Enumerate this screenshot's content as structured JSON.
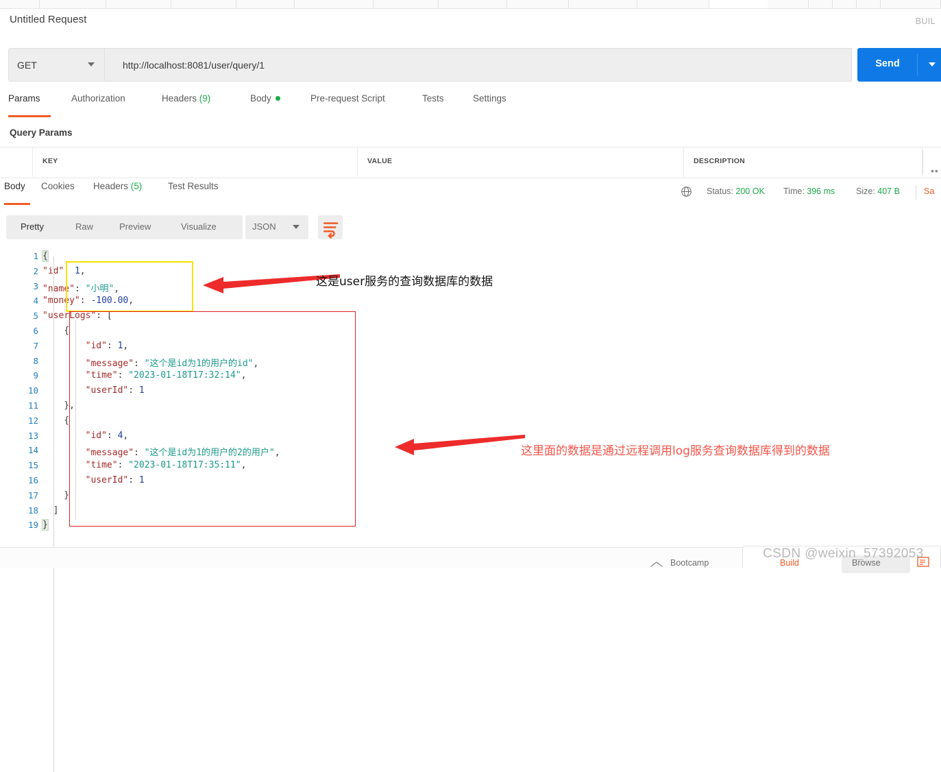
{
  "app": {
    "request_title": "Untitled Request",
    "build_label": "BUIL"
  },
  "url_bar": {
    "method": "GET",
    "url": "http://localhost:8081/user/query/1",
    "send_label": "Send"
  },
  "request_tabs": [
    {
      "label": "Params",
      "active": true
    },
    {
      "label": "Authorization",
      "active": false
    },
    {
      "label": "Headers",
      "count": "(9)",
      "active": false
    },
    {
      "label": "Body",
      "dot": true,
      "active": false
    },
    {
      "label": "Pre-request Script",
      "active": false
    },
    {
      "label": "Tests",
      "active": false
    },
    {
      "label": "Settings",
      "active": false
    }
  ],
  "params": {
    "section_title": "Query Params",
    "columns": [
      "KEY",
      "VALUE",
      "DESCRIPTION"
    ],
    "overflow_label": "••"
  },
  "response_tabs": [
    {
      "label": "Body",
      "active": true
    },
    {
      "label": "Cookies",
      "active": false
    },
    {
      "label": "Headers",
      "count": "(5)",
      "active": false
    },
    {
      "label": "Test Results",
      "active": false
    }
  ],
  "response_meta": {
    "status_key": "Status:",
    "status_value": "200 OK",
    "time_key": "Time:",
    "time_value": "396 ms",
    "size_key": "Size:",
    "size_value": "407 B",
    "save_label": "Sa"
  },
  "body_toolbar": {
    "views": [
      {
        "label": "Pretty",
        "active": true
      },
      {
        "label": "Raw",
        "active": false
      },
      {
        "label": "Preview",
        "active": false
      },
      {
        "label": "Visualize",
        "active": false
      }
    ],
    "format": "JSON",
    "wrap_icon": "word-wrap-icon"
  },
  "response_body": {
    "language": "json",
    "line_numbers": [
      1,
      2,
      3,
      4,
      5,
      6,
      7,
      8,
      9,
      10,
      11,
      12,
      13,
      14,
      15,
      16,
      17,
      18,
      19
    ],
    "lines": [
      [
        {
          "t": "pun",
          "v": "{"
        }
      ],
      [
        {
          "t": "key",
          "v": "\"id\""
        },
        {
          "t": "pun",
          "v": ": "
        },
        {
          "t": "num",
          "v": "1"
        },
        {
          "t": "pun",
          "v": ","
        }
      ],
      [
        {
          "t": "key",
          "v": "\"name\""
        },
        {
          "t": "pun",
          "v": ": "
        },
        {
          "t": "str",
          "v": "\"小明\""
        },
        {
          "t": "pun",
          "v": ","
        }
      ],
      [
        {
          "t": "key",
          "v": "\"money\""
        },
        {
          "t": "pun",
          "v": ": "
        },
        {
          "t": "num",
          "v": "-100.00"
        },
        {
          "t": "pun",
          "v": ","
        }
      ],
      [
        {
          "t": "key",
          "v": "\"userLogs\""
        },
        {
          "t": "pun",
          "v": ": ["
        }
      ],
      [
        {
          "t": "pun",
          "v": "    {"
        }
      ],
      [
        {
          "t": "key",
          "v": "        \"id\""
        },
        {
          "t": "pun",
          "v": ": "
        },
        {
          "t": "num",
          "v": "1"
        },
        {
          "t": "pun",
          "v": ","
        }
      ],
      [
        {
          "t": "key",
          "v": "        \"message\""
        },
        {
          "t": "pun",
          "v": ": "
        },
        {
          "t": "str",
          "v": "\"这个是id为1的用户的id\""
        },
        {
          "t": "pun",
          "v": ","
        }
      ],
      [
        {
          "t": "key",
          "v": "        \"time\""
        },
        {
          "t": "pun",
          "v": ": "
        },
        {
          "t": "str",
          "v": "\"2023-01-18T17:32:14\""
        },
        {
          "t": "pun",
          "v": ","
        }
      ],
      [
        {
          "t": "key",
          "v": "        \"userId\""
        },
        {
          "t": "pun",
          "v": ": "
        },
        {
          "t": "num",
          "v": "1"
        }
      ],
      [
        {
          "t": "pun",
          "v": "    },"
        }
      ],
      [
        {
          "t": "pun",
          "v": "    {"
        }
      ],
      [
        {
          "t": "key",
          "v": "        \"id\""
        },
        {
          "t": "pun",
          "v": ": "
        },
        {
          "t": "num",
          "v": "4"
        },
        {
          "t": "pun",
          "v": ","
        }
      ],
      [
        {
          "t": "key",
          "v": "        \"message\""
        },
        {
          "t": "pun",
          "v": ": "
        },
        {
          "t": "str",
          "v": "\"这个是id为1的用户的2的用户\""
        },
        {
          "t": "pun",
          "v": ","
        }
      ],
      [
        {
          "t": "key",
          "v": "        \"time\""
        },
        {
          "t": "pun",
          "v": ": "
        },
        {
          "t": "str",
          "v": "\"2023-01-18T17:35:11\""
        },
        {
          "t": "pun",
          "v": ","
        }
      ],
      [
        {
          "t": "key",
          "v": "        \"userId\""
        },
        {
          "t": "pun",
          "v": ": "
        },
        {
          "t": "num",
          "v": "1"
        }
      ],
      [
        {
          "t": "pun",
          "v": "    }"
        }
      ],
      [
        {
          "t": "pun",
          "v": "  ]"
        }
      ],
      [
        {
          "t": "pun",
          "v": "}"
        }
      ]
    ]
  },
  "annotations": [
    {
      "id": "user-service-note",
      "text": "这是user服务的查询数据库的数据",
      "color": "#141414",
      "box_color": "#ffe000"
    },
    {
      "id": "log-service-note",
      "text": "这里面的数据是通过远程调用log服务查询数据库得到的数据",
      "color": "#f4564a",
      "box_color": "#e02020"
    }
  ],
  "bottom_bar": {
    "bootcamp": "Bootcamp",
    "build": "Build",
    "browse": "Browse"
  },
  "watermark": "CSDN @weixin_57392053",
  "colors": {
    "accent_orange": "#ef5b25",
    "send_blue": "#0f7ae5",
    "status_green": "#1eab4b",
    "annotation_red": "#f4564a",
    "annotation_yellow": "#ffe000"
  }
}
